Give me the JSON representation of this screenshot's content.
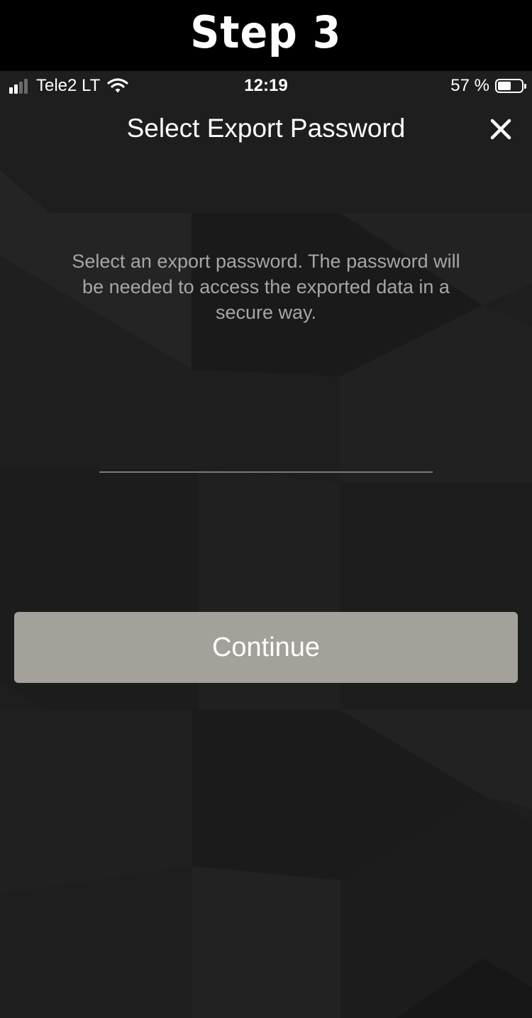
{
  "banner": {
    "title": "Step 3"
  },
  "status_bar": {
    "carrier": "Tele2 LT",
    "time": "12:19",
    "battery_text": "57 %",
    "battery_level": 0.57,
    "signal_bars_active": 2,
    "signal_bars_total": 4,
    "icons": [
      "signal-icon",
      "wifi-icon",
      "battery-icon"
    ]
  },
  "screen": {
    "title": "Select Export Password",
    "close_icon": "close-icon",
    "description": "Select an export password. The password will be needed to access the exported data in a secure way.",
    "password_value": "",
    "continue_label": "Continue"
  },
  "colors": {
    "background": "#1e1e1e",
    "banner_background": "#000000",
    "button_background": "#a3a19a",
    "description_text": "#a6a6a6"
  }
}
